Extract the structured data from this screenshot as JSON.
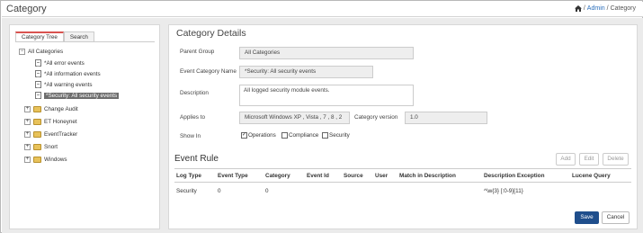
{
  "header": {
    "title": "Category",
    "breadcrumb": {
      "sep1": "/",
      "admin": "Admin",
      "sep2": "/",
      "current": "Category"
    }
  },
  "left": {
    "tabs": [
      "Category Tree",
      "Search"
    ],
    "tree": {
      "root": "All Categories",
      "children": [
        "*All error events",
        "*All information events",
        "*All warning events",
        "*Security: All security events"
      ],
      "groups": [
        "Change Audit",
        "ET Honeynet",
        "EventTracker",
        "Snort",
        "Windows"
      ]
    }
  },
  "details": {
    "heading": "Category Details",
    "parent_group_label": "Parent Group",
    "parent_group_value": "All Categories",
    "event_category_name_label": "Event Category Name",
    "event_category_name_value": "*Security: All security events",
    "description_label": "Description",
    "description_value": "All logged security module events.",
    "applies_to_label": "Applies to",
    "applies_to_value": "Microsoft Windows XP , Vista , 7 , 8 , 2",
    "category_version_label": "Category version",
    "category_version_value": "1.0",
    "show_in_label": "Show In",
    "show_in_options": [
      {
        "label": "Operations",
        "checked": true
      },
      {
        "label": "Compliance",
        "checked": false
      },
      {
        "label": "Security",
        "checked": false
      }
    ]
  },
  "event_rule": {
    "heading": "Event Rule",
    "buttons": {
      "add": "Add",
      "edit": "Edit",
      "delete": "Delete"
    },
    "columns": [
      "Log Type",
      "Event Type",
      "Category",
      "Event Id",
      "Source",
      "User",
      "Match in Description",
      "Description Exception",
      "Lucene Query"
    ],
    "rows": [
      {
        "log_type": "Security",
        "event_type": "0",
        "category": "0",
        "description_exception": "^\\w{3} [:0-9]{11}"
      }
    ]
  },
  "footer": {
    "save": "Save",
    "cancel": "Cancel"
  },
  "colors": {
    "accent": "#1f4e8c",
    "selected_bg": "#6d6d6d",
    "tab_accent": "#d9534f",
    "link": "#2a6ebb"
  }
}
